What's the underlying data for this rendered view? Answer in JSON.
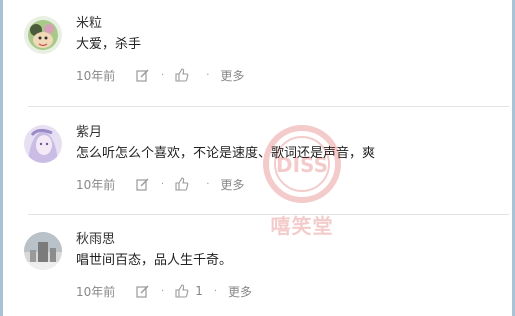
{
  "comments": [
    {
      "username": "米粒",
      "text": "大爱，杀手",
      "time": "10年前",
      "likes": "",
      "more": "更多",
      "avatar_icon": "cartoon-avatar-icon",
      "avatar_color": "#6c8a4a"
    },
    {
      "username": "紫月",
      "text": "怎么听怎么个喜欢，不论是速度、歌词还是声音，爽",
      "time": "10年前",
      "likes": "",
      "more": "更多",
      "avatar_icon": "anime-avatar-icon",
      "avatar_color": "#b6a6d8"
    },
    {
      "username": "秋雨思",
      "text": "唱世间百态，品人生千奇。",
      "time": "10年前",
      "likes": "1",
      "more": "更多",
      "avatar_icon": "photo-avatar-icon",
      "avatar_color": "#8a8a8a"
    }
  ],
  "watermark": {
    "badge_text": "DISS",
    "caption": "嘻笑堂",
    "color": "#d01818"
  },
  "colors": {
    "text": "#222222",
    "muted": "#888888",
    "divider": "#e3e3e3",
    "frame": "#a9c3d6"
  }
}
